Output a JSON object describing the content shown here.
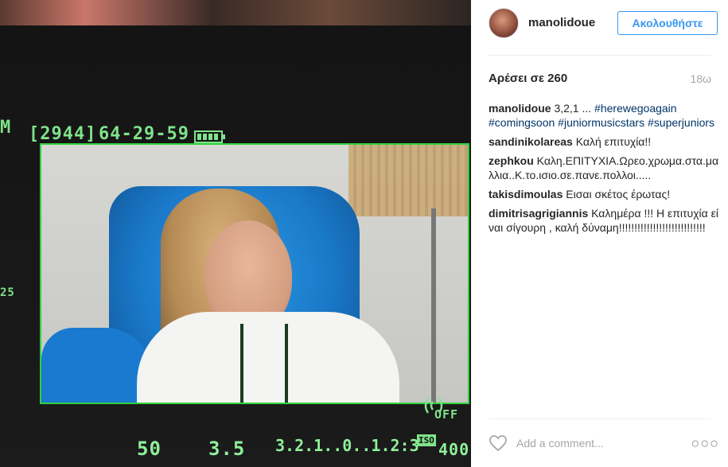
{
  "post": {
    "username": "manolidoue",
    "follow_label": "Ακολουθήστε",
    "likes": "Αρέσει σε 260",
    "time_ago": "18ω"
  },
  "caption": {
    "user": "manolidoue",
    "text": "3,2,1 ...",
    "hashtags": [
      "#herewegoagain",
      "#comingsoon",
      "#juniormusicstars",
      "#superjuniors"
    ]
  },
  "comments": [
    {
      "user": "sandinikolareas",
      "text": "Καλή επιτυχία!!"
    },
    {
      "user": "zephkou",
      "text": "Καλη.ΕΠΙΤΥΧΙΑ.Ωρεο.χρωμα.στα.μαλλια..Κ.το.ισιο.σε.πανε.πολλοι....."
    },
    {
      "user": "takisdimoulas",
      "text": "Εισαι σκέτος έρωτας!"
    },
    {
      "user": "dimitrisagrigiannis",
      "text": "Καλημέρα !!! Η επιτυχία είναι σίγουρη , καλή δύναμη!!!!!!!!!!!!!!!!!!!!!!!!!!!!"
    }
  ],
  "add_comment": {
    "placeholder": "Add a comment..."
  },
  "more_label": "○○○",
  "photo_hud": {
    "counter": "[2944]",
    "timecode": "64-29-59",
    "left_mark": "M",
    "left_number": "25",
    "shutter": "50",
    "aperture": "3.5",
    "exposure_scale": "3.2.1..0..1.2:3",
    "iso_label": "ISO",
    "iso": "400",
    "stabilizer": "OFF"
  },
  "colors": {
    "accent": "#3897f0",
    "hashtag": "#003569",
    "hud": "#2fd23f",
    "muted": "#a5a7aa"
  },
  "icons": {
    "heart": "heart-icon",
    "more": "more-options-icon",
    "battery": "battery-icon"
  }
}
